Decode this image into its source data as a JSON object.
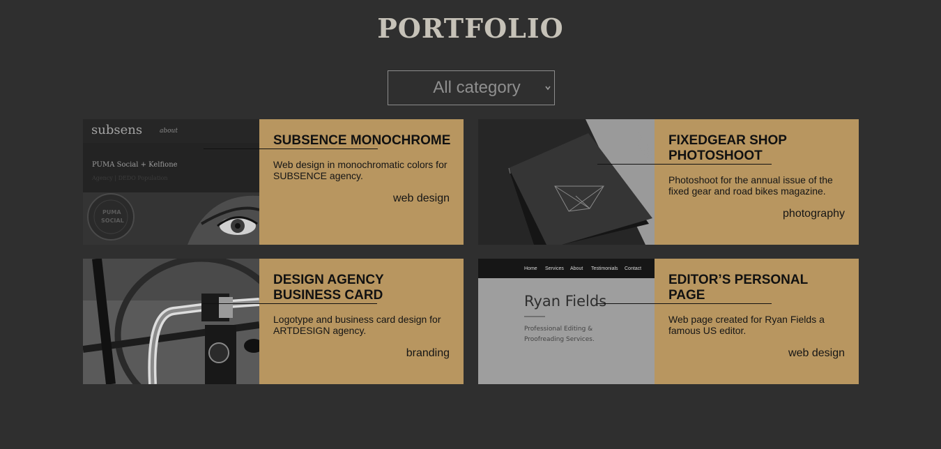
{
  "header": {
    "title": "PORTFOLIO"
  },
  "filter": {
    "selected": "All category"
  },
  "colors": {
    "background": "#2f2f2f",
    "card": "#b89660",
    "title": "#c6c2b8"
  },
  "projects": [
    {
      "title": "SUBSENCE MONOCHROME",
      "description": "Web design in monochromatic colors for SUBSENCE agency.",
      "category": "web design",
      "thumb": {
        "logo": "subsens",
        "nav": "about",
        "headline": "PUMA Social + Kelfione",
        "sub": "Agency | DEDO Population",
        "badge_top": "PUMA",
        "badge_bottom": "SOCIAL"
      }
    },
    {
      "title": "FIXEDGEAR SHOP PHOTOSHOOT",
      "description": "Photoshoot for the annual issue of the fixed gear and road bikes magazine.",
      "category": "photography",
      "thumb": {}
    },
    {
      "title": "DESIGN AGENCY BUSINESS CARD",
      "description": "Logotype and business card design for ARTDESIGN agency.",
      "category": "branding",
      "thumb": {}
    },
    {
      "title": "EDITOR’S PERSONAL PAGE",
      "description": "Web page created for Ryan Fields a famous US editor.",
      "category": "web design",
      "thumb": {
        "nav": [
          "Home",
          "Services",
          "About",
          "Testimonials",
          "Contact"
        ],
        "name": "Ryan Fields",
        "tagline1": "Professional Editing &",
        "tagline2": "Proofreading Services."
      }
    }
  ]
}
